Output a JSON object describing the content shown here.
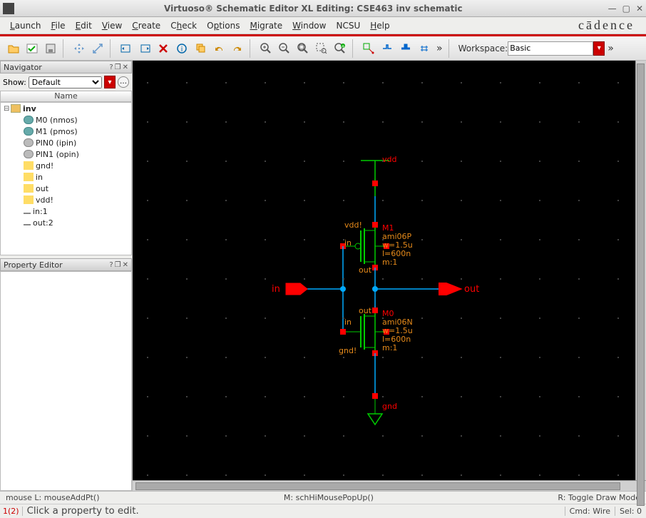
{
  "title": "Virtuoso® Schematic Editor XL Editing: CSE463 inv schematic",
  "menus": [
    "Launch",
    "File",
    "Edit",
    "View",
    "Create",
    "Check",
    "Options",
    "Migrate",
    "Window",
    "NCSU",
    "Help"
  ],
  "brand": "cādence",
  "workspace_label": "Workspace:",
  "workspace_value": "Basic",
  "navigator": {
    "title": "Navigator",
    "show_label": "Show:",
    "show_value": "Default",
    "col_header": "Name",
    "tree": [
      {
        "icon": "folder",
        "label": "inv",
        "exp": "⊟",
        "depth": 0,
        "bold": true
      },
      {
        "icon": "mos",
        "label": "M0 (nmos)",
        "depth": 1
      },
      {
        "icon": "mos",
        "label": "M1 (pmos)",
        "depth": 1
      },
      {
        "icon": "pin",
        "label": "PIN0 (ipin)",
        "depth": 1
      },
      {
        "icon": "pin",
        "label": "PIN1 (opin)",
        "depth": 1
      },
      {
        "icon": "gnd",
        "label": "gnd!",
        "depth": 1
      },
      {
        "icon": "gnd",
        "label": "in",
        "depth": 1
      },
      {
        "icon": "gnd",
        "label": "out",
        "depth": 1
      },
      {
        "icon": "gnd",
        "label": "vdd!",
        "depth": 1
      },
      {
        "icon": "net",
        "label": "in:1",
        "depth": 1
      },
      {
        "icon": "net",
        "label": "out:2",
        "depth": 1
      }
    ]
  },
  "property_editor": {
    "title": "Property Editor"
  },
  "schematic": {
    "vdd_label": "vdd",
    "gnd_label": "gnd",
    "in_label": "in",
    "out_label": "out",
    "m1": {
      "name": "M1",
      "model": "ami06P",
      "w": "w=1.5u",
      "l": "l=600n",
      "m": "m:1",
      "vdd": "vdd!",
      "body_in": "in",
      "drain": "out"
    },
    "m0": {
      "name": "M0",
      "model": "ami06N",
      "w": "w=1.5u",
      "l": "l=600n",
      "m": "m:1",
      "gnd": "gnd!",
      "body_in": "in",
      "drain": "out"
    }
  },
  "status1": {
    "left": "mouse L: mouseAddPt()",
    "mid": "M: schHiMousePopUp()",
    "right": "R: Toggle Draw Mode"
  },
  "status2": {
    "left": "1(2)",
    "prompt": "Click a property to edit.",
    "cmd": "Cmd: Wire",
    "sel": "Sel: 0"
  }
}
